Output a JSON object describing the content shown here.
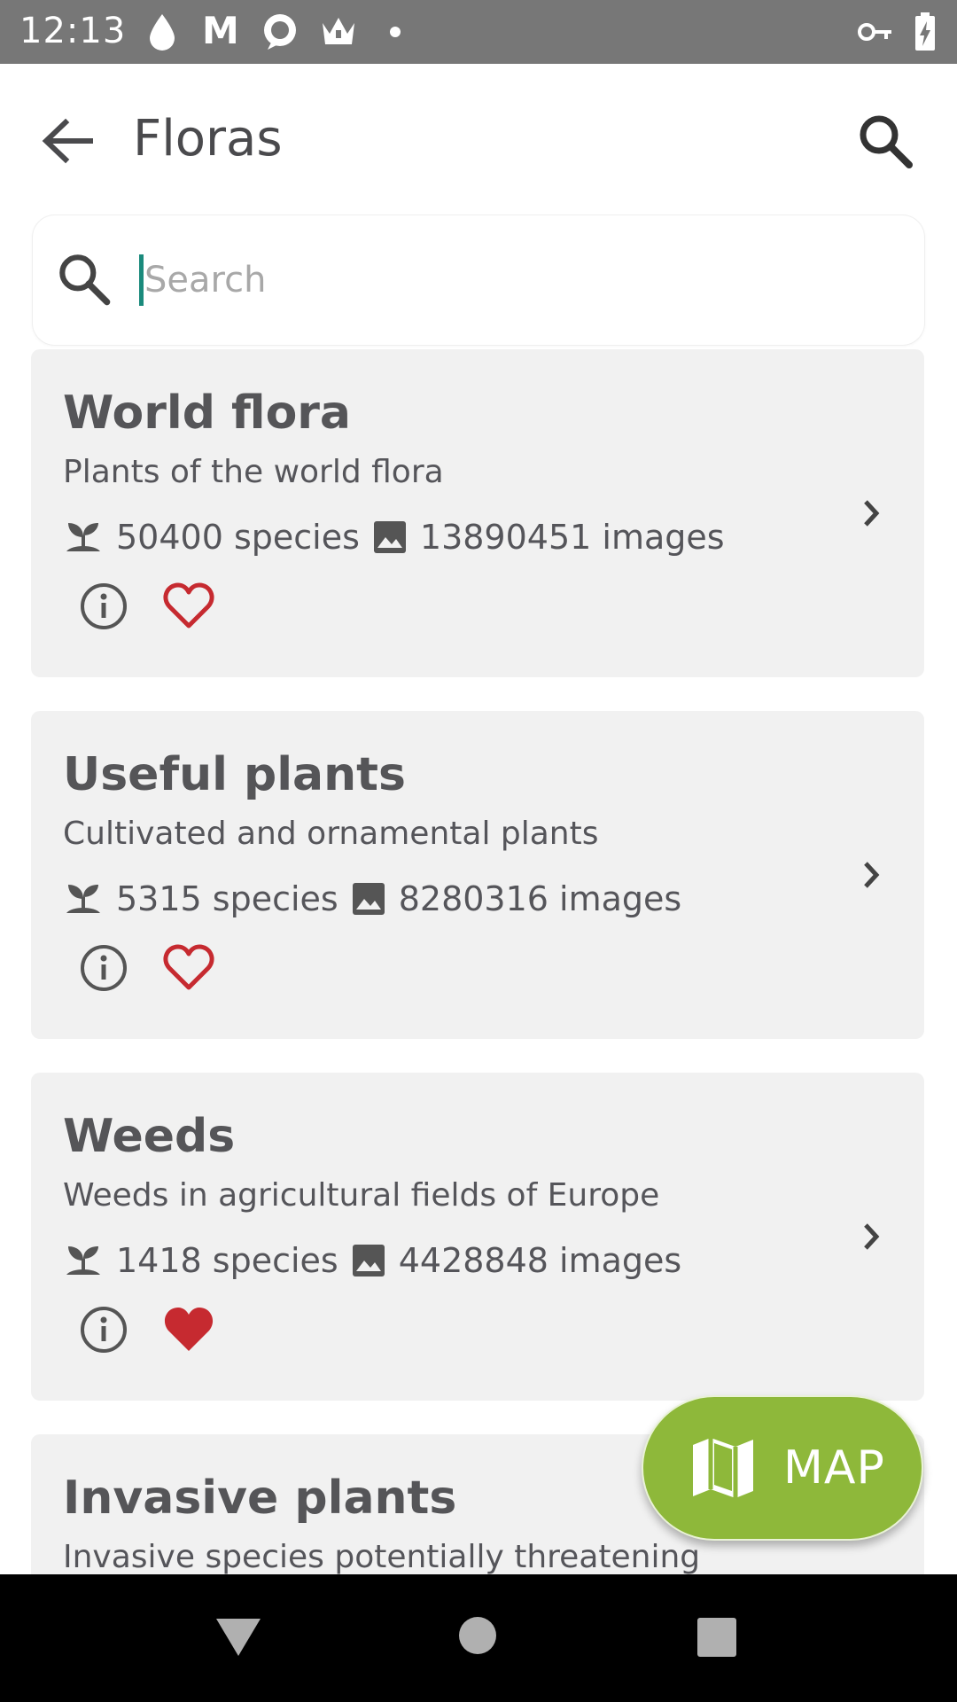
{
  "status_bar": {
    "time": "12:13",
    "m_icon_label": "M"
  },
  "app_bar": {
    "title": "Floras"
  },
  "search": {
    "placeholder": "Search",
    "value": ""
  },
  "floras": [
    {
      "title": "World flora",
      "subtitle": "Plants of the world flora",
      "species": "50400 species",
      "images": "13890451 images",
      "favorite": false
    },
    {
      "title": "Useful plants",
      "subtitle": "Cultivated and ornamental plants",
      "species": "5315 species",
      "images": "8280316 images",
      "favorite": false
    },
    {
      "title": "Weeds",
      "subtitle": "Weeds in agricultural fields of Europe",
      "species": "1418 species",
      "images": "4428848 images",
      "favorite": true
    },
    {
      "title": "Invasive plants",
      "subtitle": "Invasive species potentially threatening",
      "species": "",
      "images": "",
      "favorite": false
    }
  ],
  "fab": {
    "label": "MAP"
  },
  "colors": {
    "accent_green": "#8eb83a",
    "heart_red": "#c62a30",
    "caret_teal": "#1a8a7c",
    "card_bg": "#f1f1f1"
  }
}
